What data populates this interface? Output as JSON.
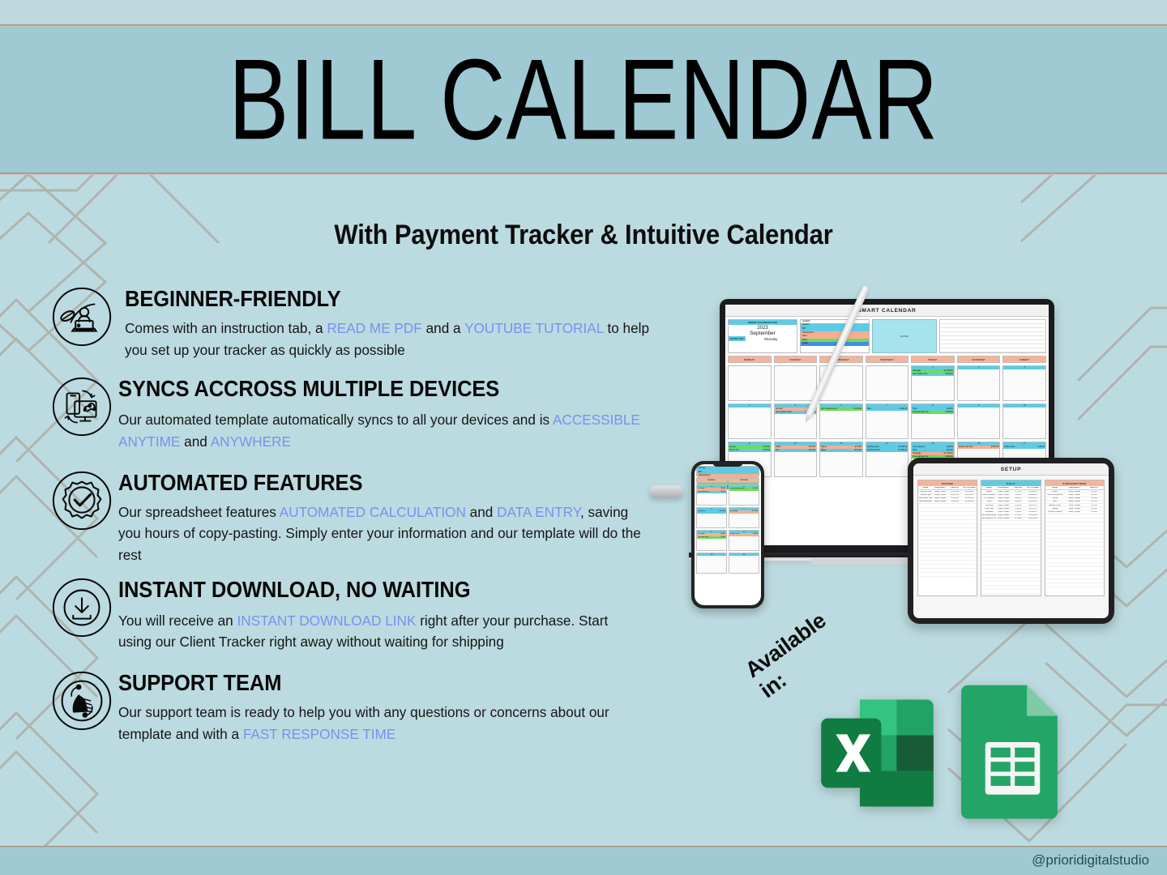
{
  "header": {
    "title": "BILL CALENDAR",
    "subtitle": "With Payment Tracker & Intuitive Calendar"
  },
  "features": [
    {
      "icon": "person-laptop-leaf-icon",
      "title": "BEGINNER-FRIENDLY",
      "desc_parts": [
        {
          "t": "Comes with an instruction tab, a ",
          "hl": false
        },
        {
          "t": "READ ME PDF",
          "hl": true
        },
        {
          "t": " and a ",
          "hl": false
        },
        {
          "t": "YOUTUBE TUTORIAL",
          "hl": true
        },
        {
          "t": " to help you set up your tracker as quickly as possible",
          "hl": false
        }
      ]
    },
    {
      "icon": "multi-device-sync-icon",
      "title": "SYNCS ACCROSS MULTIPLE DEVICES",
      "desc_parts": [
        {
          "t": "Our automated template automatically syncs to all your devices and is ",
          "hl": false
        },
        {
          "t": "ACCESSIBLE ANYTIME",
          "hl": true
        },
        {
          "t": " and ",
          "hl": false
        },
        {
          "t": "ANYWHERE",
          "hl": true
        }
      ]
    },
    {
      "icon": "gear-checkmark-icon",
      "title": "AUTOMATED FEATURES",
      "desc_parts": [
        {
          "t": "Our spreadsheet features ",
          "hl": false
        },
        {
          "t": "AUTOMATED CALCULATION",
          "hl": true
        },
        {
          "t": " and ",
          "hl": false
        },
        {
          "t": "DATA ENTRY",
          "hl": true
        },
        {
          "t": ", saving you hours of copy-pasting. Simply enter your information and our template will do the rest",
          "hl": false
        }
      ]
    },
    {
      "icon": "download-arrow-icon",
      "title": "INSTANT DOWNLOAD, NO WAITING",
      "desc_parts": [
        {
          "t": "You will receive an ",
          "hl": false
        },
        {
          "t": "INSTANT DOWNLOAD LINK",
          "hl": true
        },
        {
          "t": " right after your purchase. Start using our Client Tracker right away without waiting for shipping",
          "hl": false
        }
      ]
    },
    {
      "icon": "handshake-support-icon",
      "title": "SUPPORT TEAM",
      "desc_parts": [
        {
          "t": "Our support team is ready to help you with any questions or concerns about our template and with a ",
          "hl": false
        },
        {
          "t": "FAST RESPONSE TIME",
          "hl": true
        }
      ]
    }
  ],
  "devices": {
    "laptop": {
      "sheet_title": "SMART CALENDAR",
      "control": {
        "header": "SMART CALENDAR FOR",
        "year": "2023",
        "month": "September",
        "start_day_label": "START DAY",
        "start_day_value": "Monday"
      },
      "legend_title": "LEGEND",
      "legend": [
        {
          "label": "Income",
          "color": "#5fcbe3"
        },
        {
          "label": "Bill",
          "color": "#5fcbe3"
        },
        {
          "label": "Subscription",
          "color": "#f5ae92"
        },
        {
          "label": "Debt",
          "color": "#f5ae92"
        },
        {
          "label": "Food",
          "color": "#6fdb5c"
        },
        {
          "label": "Today",
          "color": "#3f8fe0"
        }
      ],
      "notes_label": "NOTES",
      "day_headers": [
        "MONDAY",
        "TUESDAY",
        "WEDNESDAY",
        "THURSDAY",
        "FRIDAY",
        "SATURDAY",
        "SUNDAY"
      ],
      "cells": [
        {
          "day": "",
          "events": []
        },
        {
          "day": "",
          "events": []
        },
        {
          "day": "",
          "events": []
        },
        {
          "day": "",
          "events": []
        },
        {
          "day": "1",
          "events": [
            {
              "name": "Mortgage",
              "amount": "$ 4,000.00",
              "tone": "g"
            },
            {
              "name": "Side Hustle John",
              "amount": "$   500.00",
              "tone": "b"
            }
          ]
        },
        {
          "day": "2",
          "events": []
        },
        {
          "day": "3",
          "events": []
        },
        {
          "day": "4",
          "events": []
        },
        {
          "day": "5",
          "events": [
            {
              "name": "Car loan",
              "amount": "$    800.00",
              "tone": "o"
            },
            {
              "name": "Life insurance John",
              "amount": "$    120.00",
              "tone": "b"
            }
          ]
        },
        {
          "day": "6",
          "events": [
            {
              "name": "Life insurance Ann",
              "amount": "$    170.00",
              "tone": "g"
            }
          ]
        },
        {
          "day": "7",
          "events": [
            {
              "name": "HOA",
              "amount": "$    300.00",
              "tone": "b"
            }
          ]
        },
        {
          "day": "8",
          "events": [
            {
              "name": "HOA",
              "amount": "$      40.00",
              "tone": "b"
            },
            {
              "name": "Personal loan Ann",
              "amount": "$    200.00",
              "tone": "g"
            }
          ]
        },
        {
          "day": "9",
          "events": []
        },
        {
          "day": "10",
          "events": []
        },
        {
          "day": "11",
          "events": [
            {
              "name": "Internet",
              "amount": "$      70.00",
              "tone": "g"
            },
            {
              "name": "Phone Ann",
              "amount": "$      40.00",
              "tone": "b"
            }
          ]
        },
        {
          "day": "12",
          "events": [
            {
              "name": "Netflix",
              "amount": "$      15.00",
              "tone": "o"
            },
            {
              "name": "Hulu",
              "amount": "$      12.00",
              "tone": "b"
            }
          ]
        },
        {
          "day": "13",
          "events": [
            {
              "name": "Disney",
              "amount": "$      30.00",
              "tone": "o"
            },
            {
              "name": "Water",
              "amount": "$      60.00",
              "tone": "b"
            }
          ]
        },
        {
          "day": "14",
          "events": [
            {
              "name": "Paycheck Ann",
              "amount": "$ 4,000.00",
              "tone": "b"
            },
            {
              "name": "Paycheck John",
              "amount": "$ 2,500.00",
              "tone": "b"
            }
          ]
        },
        {
          "day": "15",
          "events": [
            {
              "name": "Car insurance",
              "amount": "$      80.00",
              "tone": "b"
            },
            {
              "name": "HOA",
              "amount": "$      40.00",
              "tone": "b"
            },
            {
              "name": "Mortgage",
              "amount": "$ 1,200.00",
              "tone": "o"
            },
            {
              "name": "Personal loan Ann",
              "amount": "$    200.00",
              "tone": "g"
            }
          ]
        },
        {
          "day": "16",
          "events": [
            {
              "name": "Credit Card John",
              "amount": "$    500.00",
              "tone": "o"
            }
          ]
        },
        {
          "day": "17",
          "events": [
            {
              "name": "Phone John",
              "amount": "$      45.00",
              "tone": "b"
            }
          ]
        }
      ]
    },
    "tablet": {
      "sheet_title": "SETUP",
      "tables": [
        {
          "name": "INCOME",
          "tone": "inc",
          "columns": [
            "NAME",
            "FREQUENCY",
            "AMOUNT",
            "1ST PAYMENT"
          ],
          "rows": [
            [
              "Paycheck John",
              "Every 2 Week",
              "$ 2,500.00",
              "2023-09-01"
            ],
            [
              "Paycheck Ann",
              "Every 2 Week",
              "$ 4,000.00",
              "2023-09-01"
            ],
            [
              "Side Hustle John",
              "Every 1 Month",
              "$    500.00",
              "2023-09-01"
            ],
            [
              "Side Hustle Ann",
              "Every 1 Month",
              "$    300.00",
              "2023-09-01"
            ]
          ]
        },
        {
          "name": "BILLS",
          "tone": "bil",
          "columns": [
            "NAME",
            "FREQUENCY",
            "AMOUNT",
            "1ST PAYMENT"
          ],
          "rows": [
            [
              "Internet",
              "Every 1 Month",
              "$   70.00",
              "2023-09-11"
            ],
            [
              "Home Insurance",
              "Every 1 Month",
              "$   60.00",
              "2023-09-05"
            ],
            [
              "Car Insurance",
              "Every 1 Month",
              "$   80.00",
              "2023-09-15"
            ],
            [
              "HOA",
              "Every 1 Month",
              "$   40.00",
              "2023-09-07"
            ],
            [
              "Electricity",
              "Every 1 Month",
              "$   90.00",
              "2023-09-21"
            ],
            [
              "Phone John",
              "Every 1 Month",
              "$   45.00",
              "2023-09-17"
            ],
            [
              "Phone Ann",
              "Every 1 Month",
              "$   40.00",
              "2023-09-11"
            ],
            [
              "Life Insurance Ann",
              "Every 1 Month",
              "$   70.00",
              "2023-09-06"
            ],
            [
              "Life Insurance John",
              "Every 1 Month",
              "$ 120.00",
              "2023-09-05"
            ]
          ]
        },
        {
          "name": "SUBSCRIPTIONS",
          "tone": "sub",
          "columns": [
            "NAME",
            "FREQUENCY",
            "AMOUNT"
          ],
          "rows": [
            [
              "Netflix",
              "Every 1 Month",
              "$ 15.00"
            ],
            [
              "Costco Membership",
              "Every 1 Month",
              "$ 12.00"
            ],
            [
              "Disney",
              "Every 1 Month",
              "$ 30.00"
            ],
            [
              "Hulu",
              "Every 1 Month",
              "$ 12.00"
            ],
            [
              "Amazon Prime",
              "Every 1 Month",
              "$ 15.00"
            ],
            [
              "Spotify",
              "Every 1 Month",
              "$ 10.00"
            ],
            [
              "YouTube Premium",
              "Every 1 Month",
              "$ 14.00"
            ]
          ]
        }
      ]
    },
    "phone": {
      "day_headers": [
        "MONDAY",
        "TUESDAY"
      ],
      "cells": [
        {
          "day": "4",
          "events": [
            {
              "name": "Car loan",
              "amount": "$ 800",
              "tone": "o"
            },
            {
              "name": "Life insurance",
              "amount": "$ 120",
              "tone": "b"
            }
          ]
        },
        {
          "day": "5",
          "events": [
            {
              "name": "Life insurance Ann",
              "amount": "$ 170",
              "tone": "g"
            }
          ]
        },
        {
          "day": "6",
          "events": [
            {
              "name": "Paycheck",
              "amount": "$ 4,000",
              "tone": "b"
            }
          ]
        },
        {
          "day": "7",
          "events": [
            {
              "name": "Mortgage",
              "amount": "$ 1,200",
              "tone": "o"
            }
          ]
        },
        {
          "day": "8",
          "events": [
            {
              "name": "Car loan",
              "amount": "$ 800",
              "tone": "o"
            },
            {
              "name": "Personal loan",
              "amount": "$ 200",
              "tone": "g"
            }
          ]
        },
        {
          "day": "9",
          "events": [
            {
              "name": "Credit Card",
              "amount": "$ 500",
              "tone": "o"
            }
          ]
        },
        {
          "day": "10",
          "events": []
        },
        {
          "day": "11",
          "events": []
        }
      ]
    }
  },
  "available": {
    "label": "Available in:",
    "apps": [
      "microsoft-excel",
      "google-sheets"
    ]
  },
  "footer": {
    "handle": "@prioridigitalstudio"
  },
  "colors": {
    "background": "#bcdbe0",
    "band": "#9fc9d3",
    "accent_text": "#7b8ff0",
    "rule": "#a89a88",
    "chevron": "#a89f92",
    "excel_green": "#1d7044",
    "sheets_green": "#23a566"
  }
}
